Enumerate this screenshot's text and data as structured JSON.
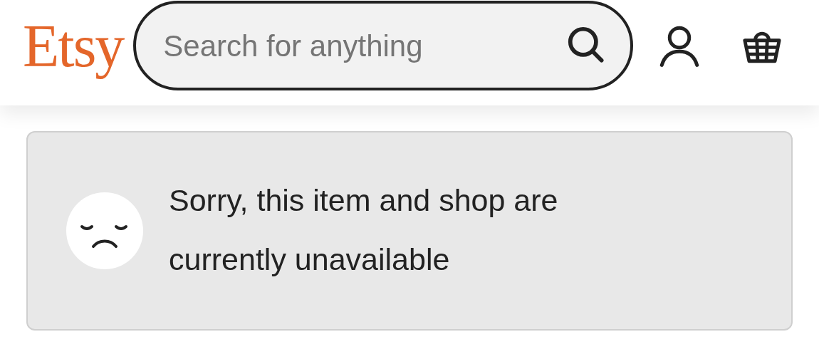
{
  "header": {
    "logo": "Etsy",
    "search": {
      "placeholder": "Search for anything"
    }
  },
  "notice": {
    "message": "Sorry, this item and shop are currently unavailable"
  }
}
